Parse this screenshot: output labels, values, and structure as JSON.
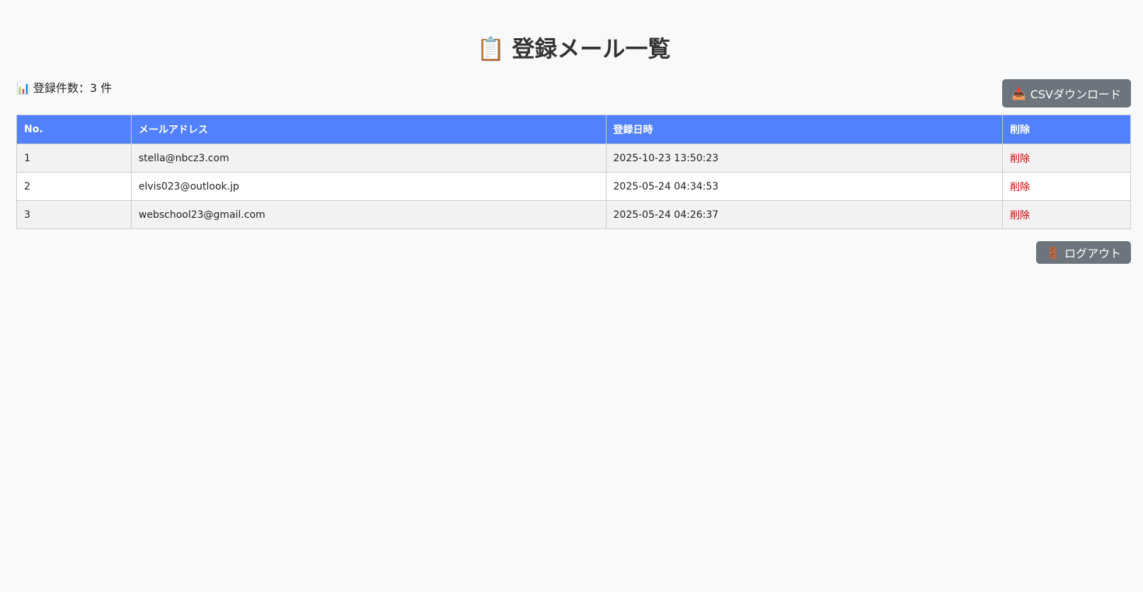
{
  "header": {
    "title_icon": "📋",
    "title": "登録メール一覧"
  },
  "summary": {
    "icon": "📊",
    "count_text": "登録件数：3 件"
  },
  "toolbar": {
    "csv_icon": "📥",
    "csv_label": "CSVダウンロード",
    "logout_icon": "🚪",
    "logout_label": "ログアウト"
  },
  "table": {
    "headers": [
      "No.",
      "メールアドレス",
      "登録日時",
      "削除"
    ],
    "rows": [
      {
        "no": "1",
        "email": "stella@nbcz3.com",
        "date": "2025-10-23 13:50:23",
        "action": "削除"
      },
      {
        "no": "2",
        "email": "elvis023@outlook.jp",
        "date": "2025-05-24 04:34:53",
        "action": "削除"
      },
      {
        "no": "3",
        "email": "webschool23@gmail.com",
        "date": "2025-05-24 04:26:37",
        "action": "削除"
      }
    ]
  },
  "colors": {
    "header_bg": "#5281ff",
    "button_bg": "#6c757d",
    "delete_link": "#cc0000",
    "page_bg": "#f8f9fa"
  }
}
